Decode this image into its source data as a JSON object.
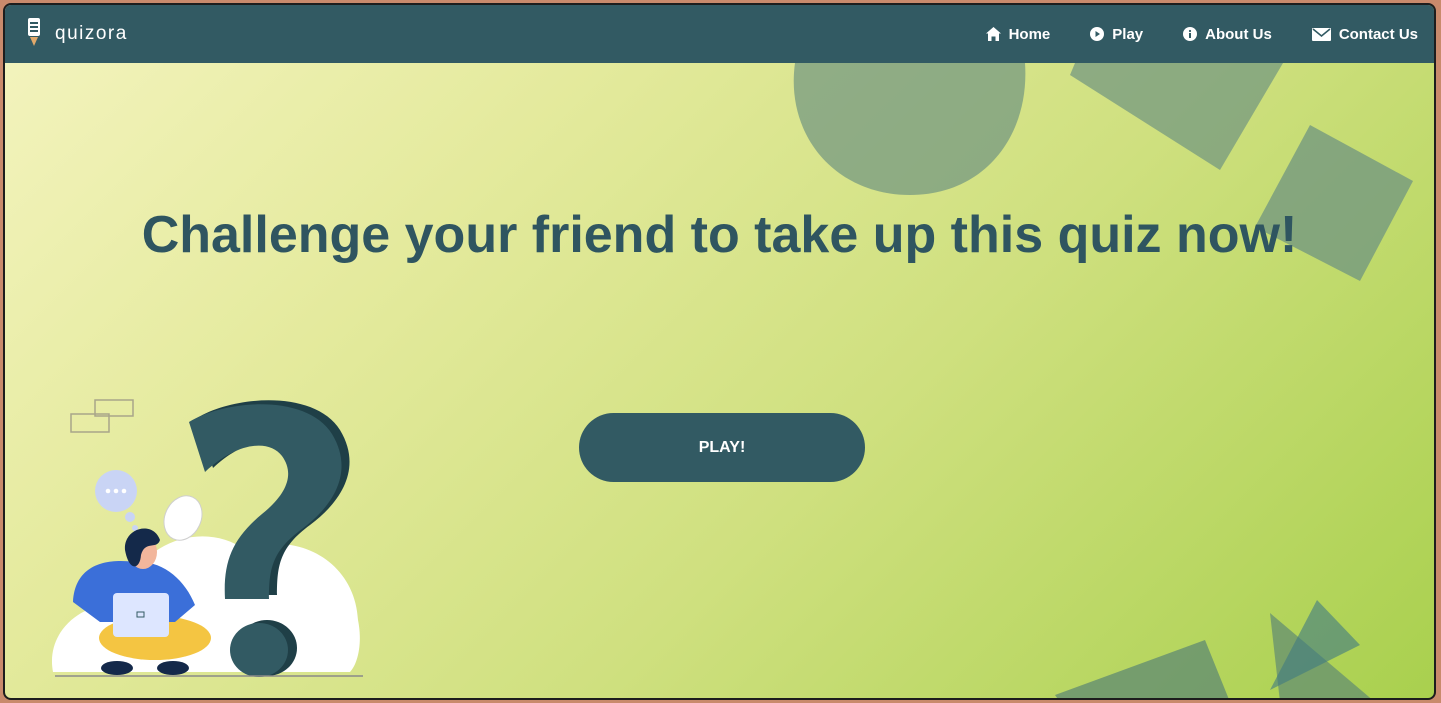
{
  "brand": {
    "name": "quizora",
    "logo_icon": "lightbulb-icon"
  },
  "nav": {
    "items": [
      {
        "label": "Home",
        "icon": "home-icon"
      },
      {
        "label": "Play",
        "icon": "play-circle-icon"
      },
      {
        "label": "About Us",
        "icon": "info-icon"
      },
      {
        "label": "Contact Us",
        "icon": "envelope-icon"
      }
    ]
  },
  "hero": {
    "headline": "Challenge your friend to take up this quiz now!",
    "play_button": "PLAY!",
    "illustration": "person-with-laptop-and-question-mark"
  },
  "colors": {
    "navbar": "#325a63",
    "headline": "#2f5560",
    "button": "#325a63",
    "gradient_start": "#f4f4bf",
    "gradient_end": "#a9d04e",
    "shape": "#7a9a80"
  }
}
